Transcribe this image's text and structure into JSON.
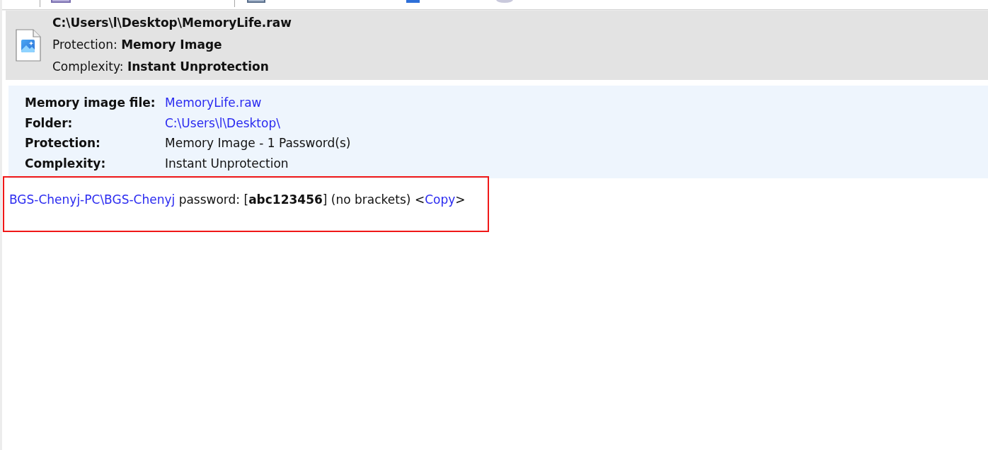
{
  "header": {
    "path": "C:\\Users\\l\\Desktop\\MemoryLife.raw",
    "lines": [
      "Protection: **Memory Image**",
      "Complexity: **Instant Unprotection**"
    ]
  },
  "details": {
    "rows": [
      {
        "label": "Memory image file:",
        "value": "MemoryLife.raw",
        "kind": "link"
      },
      {
        "label": "Folder:",
        "value": "C:\\Users\\l\\Desktop\\",
        "kind": "link"
      },
      {
        "label": "Protection:",
        "value": "Memory Image - 1 Password(s)",
        "kind": "text"
      },
      {
        "label": "Complexity:",
        "value": "Instant Unprotection",
        "kind": "text"
      }
    ]
  },
  "result": {
    "highlighted": true,
    "parts": [
      {
        "kind": "link",
        "text": "BGS-Chenyj-PC\\BGS-Chenyj"
      },
      {
        "kind": "text",
        "text": " password: [**abc123456**] (no brackets) <"
      },
      {
        "kind": "link",
        "text": "Copy"
      },
      {
        "kind": "text",
        "text": ">"
      }
    ]
  }
}
